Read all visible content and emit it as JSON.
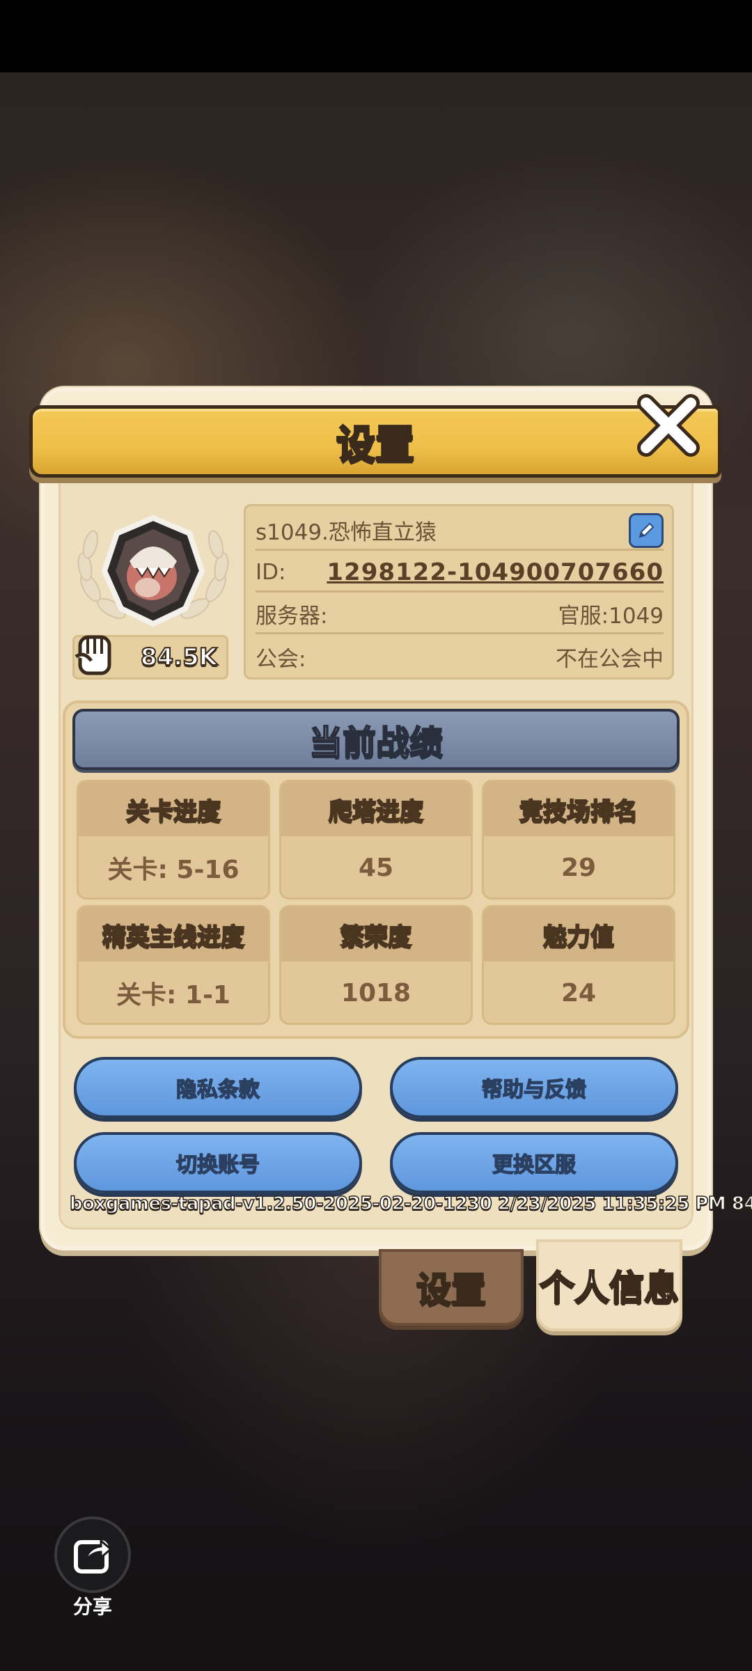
{
  "dialog": {
    "title": "设置",
    "player": {
      "name": "s1049.恐怖直立猿",
      "id_label": "ID:",
      "id_value": "1298122-104900707660",
      "server_label": "服务器:",
      "server_value": "官服:1049",
      "guild_label": "公会:",
      "guild_value": "不在公会中",
      "power": "84.5K"
    },
    "stats": {
      "header": "当前战绩",
      "items": [
        {
          "label": "关卡进度",
          "value": "关卡: 5-16"
        },
        {
          "label": "爬塔进度",
          "value": "45"
        },
        {
          "label": "竞技场排名",
          "value": "29"
        },
        {
          "label": "精英主线进度",
          "value": "关卡: 1-1"
        },
        {
          "label": "繁荣度",
          "value": "1018"
        },
        {
          "label": "魅力值",
          "value": "24"
        }
      ]
    },
    "buttons": {
      "privacy": "隐私条款",
      "help": "帮助与反馈",
      "switch_account": "切换账号",
      "change_server": "更换区服"
    },
    "version": "boxgames-tapad-v1.2.50-2025-02-20-1230 2/23/2025 11:35:25 PM 84"
  },
  "tabs": {
    "settings": "设置",
    "profile": "个人信息"
  },
  "share": {
    "label": "分享"
  },
  "colors": {
    "ribbon": "#eebf4a",
    "panel": "#f6ebd3",
    "button_blue": "#6fa6e8",
    "stats_header": "#7b8aa6"
  }
}
